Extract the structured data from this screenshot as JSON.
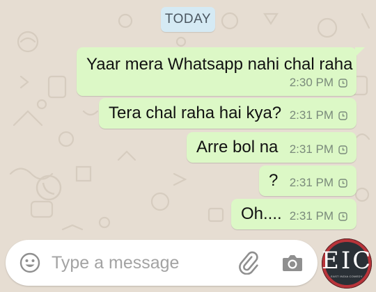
{
  "chat": {
    "date_label": "TODAY",
    "messages": [
      {
        "text": "Yaar mera Whatsapp nahi chal raha",
        "time": "2:30 PM"
      },
      {
        "text": "Tera chal raha hai kya?",
        "time": "2:31 PM"
      },
      {
        "text": "Arre bol na",
        "time": "2:31 PM"
      },
      {
        "text": "?",
        "time": "2:31 PM"
      },
      {
        "text": "Oh....",
        "time": "2:31 PM"
      }
    ]
  },
  "composer": {
    "placeholder": "Type a message",
    "value": ""
  },
  "icons": {
    "emoji": "smiley-face-icon",
    "attach": "paperclip-icon",
    "camera": "camera-icon",
    "status": "clock-pending-icon"
  },
  "logo": {
    "letters": "EIC",
    "tagline": "EAST INDIA COMEDY"
  },
  "colors": {
    "wallpaper": "#e6ddd2",
    "outgoing_bubble": "#dcf8c6",
    "date_chip": "#d5eaf4",
    "meta_text": "#7a8a7b",
    "logo_accent": "#b8343a"
  }
}
